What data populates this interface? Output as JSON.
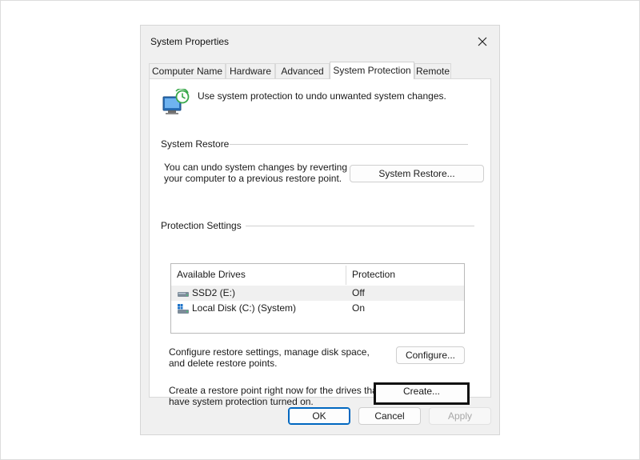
{
  "window": {
    "title": "System Properties"
  },
  "tabs": [
    {
      "label": "Computer Name"
    },
    {
      "label": "Hardware"
    },
    {
      "label": "Advanced"
    },
    {
      "label": "System Protection",
      "active": true
    },
    {
      "label": "Remote"
    }
  ],
  "intro_text": "Use system protection to undo unwanted system changes.",
  "system_restore": {
    "group_label": "System Restore",
    "description_line1": "You can undo system changes by reverting",
    "description_line2": "your computer to a previous restore point.",
    "button_label": "System Restore..."
  },
  "protection_settings": {
    "group_label": "Protection Settings",
    "columns": [
      "Available Drives",
      "Protection"
    ],
    "drives": [
      {
        "name": "SSD2 (E:)",
        "protection": "Off",
        "icon": "drive-icon",
        "selected": true
      },
      {
        "name": "Local Disk (C:) (System)",
        "protection": "On",
        "icon": "system-drive-icon",
        "selected": false
      }
    ],
    "configure_text_line1": "Configure restore settings, manage disk space,",
    "configure_text_line2": "and delete restore points.",
    "configure_button": "Configure...",
    "create_text_line1": "Create a restore point right now for the drives that",
    "create_text_line2": "have system protection turned on.",
    "create_button": "Create..."
  },
  "footer": {
    "ok": "OK",
    "cancel": "Cancel",
    "apply": "Apply"
  },
  "colors": {
    "window_bg": "#f0f0f0",
    "panel_bg": "#ffffff",
    "accent": "#0067c0",
    "shield_blue": "#1e73c8",
    "shield_green": "#3aa84b"
  }
}
